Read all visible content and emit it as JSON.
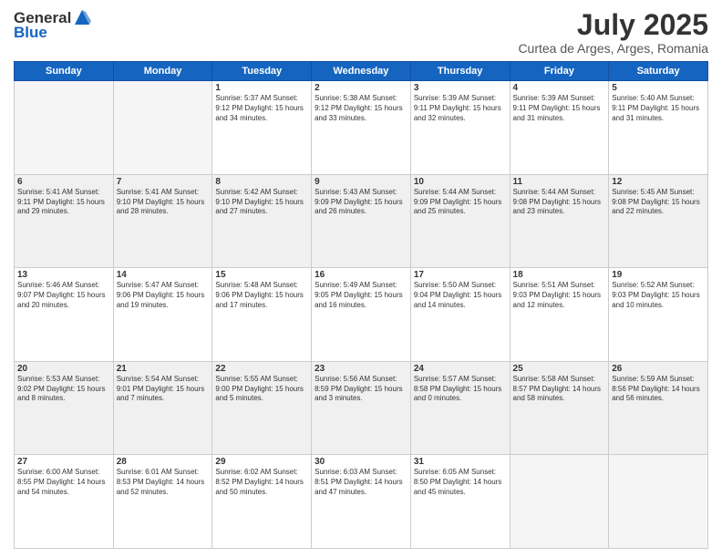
{
  "header": {
    "logo": {
      "line1": "General",
      "line2": "Blue"
    },
    "title": "July 2025",
    "subtitle": "Curtea de Arges, Arges, Romania"
  },
  "weekdays": [
    "Sunday",
    "Monday",
    "Tuesday",
    "Wednesday",
    "Thursday",
    "Friday",
    "Saturday"
  ],
  "weeks": [
    [
      {
        "day": "",
        "info": ""
      },
      {
        "day": "",
        "info": ""
      },
      {
        "day": "1",
        "info": "Sunrise: 5:37 AM\nSunset: 9:12 PM\nDaylight: 15 hours\nand 34 minutes."
      },
      {
        "day": "2",
        "info": "Sunrise: 5:38 AM\nSunset: 9:12 PM\nDaylight: 15 hours\nand 33 minutes."
      },
      {
        "day": "3",
        "info": "Sunrise: 5:39 AM\nSunset: 9:11 PM\nDaylight: 15 hours\nand 32 minutes."
      },
      {
        "day": "4",
        "info": "Sunrise: 5:39 AM\nSunset: 9:11 PM\nDaylight: 15 hours\nand 31 minutes."
      },
      {
        "day": "5",
        "info": "Sunrise: 5:40 AM\nSunset: 9:11 PM\nDaylight: 15 hours\nand 31 minutes."
      }
    ],
    [
      {
        "day": "6",
        "info": "Sunrise: 5:41 AM\nSunset: 9:11 PM\nDaylight: 15 hours\nand 29 minutes."
      },
      {
        "day": "7",
        "info": "Sunrise: 5:41 AM\nSunset: 9:10 PM\nDaylight: 15 hours\nand 28 minutes."
      },
      {
        "day": "8",
        "info": "Sunrise: 5:42 AM\nSunset: 9:10 PM\nDaylight: 15 hours\nand 27 minutes."
      },
      {
        "day": "9",
        "info": "Sunrise: 5:43 AM\nSunset: 9:09 PM\nDaylight: 15 hours\nand 26 minutes."
      },
      {
        "day": "10",
        "info": "Sunrise: 5:44 AM\nSunset: 9:09 PM\nDaylight: 15 hours\nand 25 minutes."
      },
      {
        "day": "11",
        "info": "Sunrise: 5:44 AM\nSunset: 9:08 PM\nDaylight: 15 hours\nand 23 minutes."
      },
      {
        "day": "12",
        "info": "Sunrise: 5:45 AM\nSunset: 9:08 PM\nDaylight: 15 hours\nand 22 minutes."
      }
    ],
    [
      {
        "day": "13",
        "info": "Sunrise: 5:46 AM\nSunset: 9:07 PM\nDaylight: 15 hours\nand 20 minutes."
      },
      {
        "day": "14",
        "info": "Sunrise: 5:47 AM\nSunset: 9:06 PM\nDaylight: 15 hours\nand 19 minutes."
      },
      {
        "day": "15",
        "info": "Sunrise: 5:48 AM\nSunset: 9:06 PM\nDaylight: 15 hours\nand 17 minutes."
      },
      {
        "day": "16",
        "info": "Sunrise: 5:49 AM\nSunset: 9:05 PM\nDaylight: 15 hours\nand 16 minutes."
      },
      {
        "day": "17",
        "info": "Sunrise: 5:50 AM\nSunset: 9:04 PM\nDaylight: 15 hours\nand 14 minutes."
      },
      {
        "day": "18",
        "info": "Sunrise: 5:51 AM\nSunset: 9:03 PM\nDaylight: 15 hours\nand 12 minutes."
      },
      {
        "day": "19",
        "info": "Sunrise: 5:52 AM\nSunset: 9:03 PM\nDaylight: 15 hours\nand 10 minutes."
      }
    ],
    [
      {
        "day": "20",
        "info": "Sunrise: 5:53 AM\nSunset: 9:02 PM\nDaylight: 15 hours\nand 8 minutes."
      },
      {
        "day": "21",
        "info": "Sunrise: 5:54 AM\nSunset: 9:01 PM\nDaylight: 15 hours\nand 7 minutes."
      },
      {
        "day": "22",
        "info": "Sunrise: 5:55 AM\nSunset: 9:00 PM\nDaylight: 15 hours\nand 5 minutes."
      },
      {
        "day": "23",
        "info": "Sunrise: 5:56 AM\nSunset: 8:59 PM\nDaylight: 15 hours\nand 3 minutes."
      },
      {
        "day": "24",
        "info": "Sunrise: 5:57 AM\nSunset: 8:58 PM\nDaylight: 15 hours\nand 0 minutes."
      },
      {
        "day": "25",
        "info": "Sunrise: 5:58 AM\nSunset: 8:57 PM\nDaylight: 14 hours\nand 58 minutes."
      },
      {
        "day": "26",
        "info": "Sunrise: 5:59 AM\nSunset: 8:56 PM\nDaylight: 14 hours\nand 56 minutes."
      }
    ],
    [
      {
        "day": "27",
        "info": "Sunrise: 6:00 AM\nSunset: 8:55 PM\nDaylight: 14 hours\nand 54 minutes."
      },
      {
        "day": "28",
        "info": "Sunrise: 6:01 AM\nSunset: 8:53 PM\nDaylight: 14 hours\nand 52 minutes."
      },
      {
        "day": "29",
        "info": "Sunrise: 6:02 AM\nSunset: 8:52 PM\nDaylight: 14 hours\nand 50 minutes."
      },
      {
        "day": "30",
        "info": "Sunrise: 6:03 AM\nSunset: 8:51 PM\nDaylight: 14 hours\nand 47 minutes."
      },
      {
        "day": "31",
        "info": "Sunrise: 6:05 AM\nSunset: 8:50 PM\nDaylight: 14 hours\nand 45 minutes."
      },
      {
        "day": "",
        "info": ""
      },
      {
        "day": "",
        "info": ""
      }
    ]
  ]
}
